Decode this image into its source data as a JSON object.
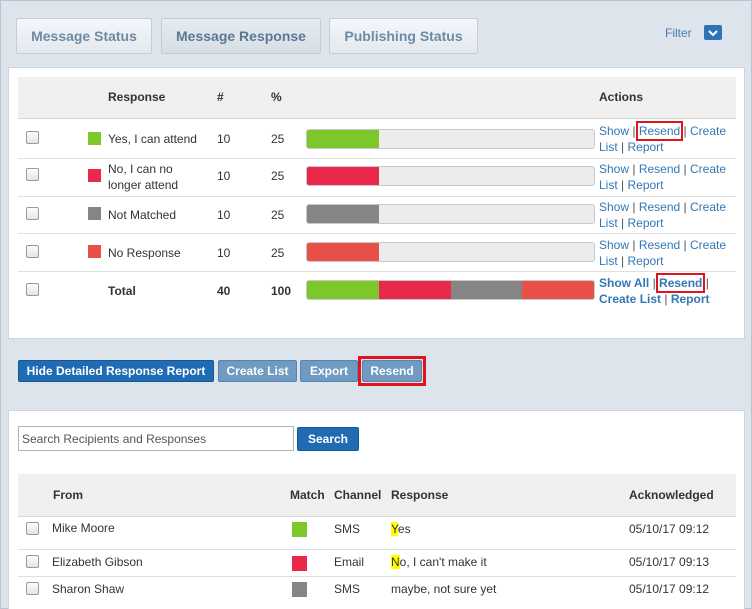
{
  "tabs": [
    {
      "label": "Message Status",
      "active": false
    },
    {
      "label": "Message Response",
      "active": true
    },
    {
      "label": "Publishing Status",
      "active": false
    }
  ],
  "filter": {
    "label": "Filter"
  },
  "response_table": {
    "headers": {
      "response": "Response",
      "count": "#",
      "percent": "%",
      "actions": "Actions"
    },
    "rows": [
      {
        "label": "Yes, I can attend",
        "count": "10",
        "percent": "25",
        "color": "#7cc82b",
        "fill": 25
      },
      {
        "label": "No, I can no longer attend",
        "count": "10",
        "percent": "25",
        "color": "#ea2849",
        "fill": 25
      },
      {
        "label": "Not Matched",
        "count": "10",
        "percent": "25",
        "color": "#858585",
        "fill": 25
      },
      {
        "label": "No Response",
        "count": "10",
        "percent": "25",
        "color": "#e8504a",
        "fill": 25
      }
    ],
    "total": {
      "label": "Total",
      "count": "40",
      "percent": "100"
    },
    "actions": {
      "show": "Show",
      "resend": "Resend",
      "create_list": "Create List",
      "report": "Report",
      "show_all": "Show All"
    }
  },
  "buttons": {
    "hide_report": "Hide Detailed Response Report",
    "create_list": "Create List",
    "export": "Export",
    "resend": "Resend"
  },
  "search": {
    "placeholder": "Search Recipients and Responses",
    "button": "Search"
  },
  "recipients": {
    "headers": {
      "from": "From",
      "match": "Match",
      "channel": "Channel",
      "response": "Response",
      "acknowledged": "Acknowledged"
    },
    "rows": [
      {
        "from": "Mike Moore",
        "color": "#7cc82b",
        "channel": "SMS",
        "resp_first": "Y",
        "resp_rest": "es",
        "acknowledged": "05/10/17 09:12"
      },
      {
        "from": "Elizabeth Gibson",
        "color": "#ea2849",
        "channel": "Email",
        "resp_first": "N",
        "resp_rest": "o, I can't make it",
        "acknowledged": "05/10/17 09:13"
      },
      {
        "from": "Sharon Shaw",
        "color": "#858585",
        "channel": "SMS",
        "resp_first": "",
        "resp_rest": "maybe, not sure yet",
        "acknowledged": "05/10/17 09:12"
      }
    ]
  }
}
